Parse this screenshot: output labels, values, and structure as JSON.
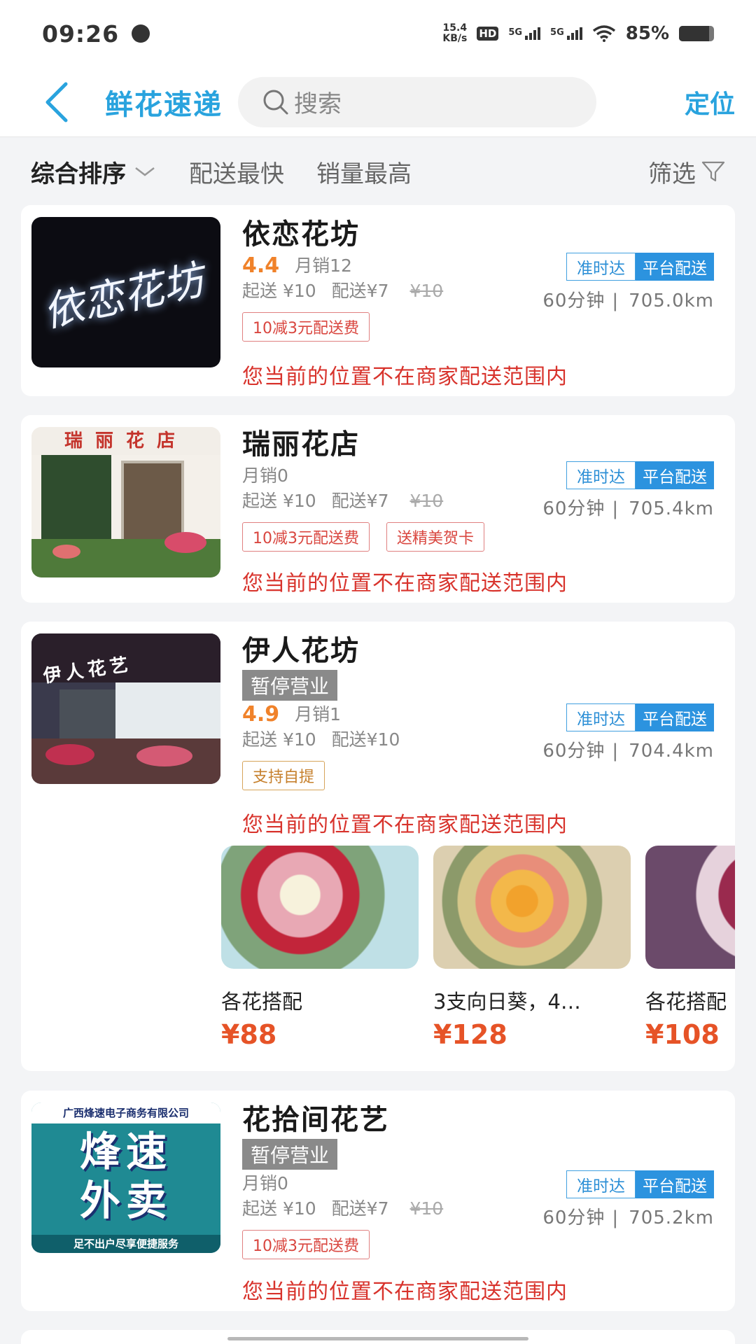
{
  "status_bar": {
    "time": "09:26",
    "net_speed_value": "15.4",
    "net_speed_unit": "KB/s",
    "hd_label": "HD",
    "network_1": "5G",
    "network_2": "5G",
    "battery_text": "85%",
    "battery_level": 0.85
  },
  "header": {
    "title": "鲜花速递",
    "search_placeholder": "搜索",
    "locate_label": "定位"
  },
  "sort_bar": {
    "items": [
      {
        "label": "综合排序"
      },
      {
        "label": "配送最快"
      },
      {
        "label": "销量最高"
      }
    ],
    "filter_label": "筛选"
  },
  "shops": [
    {
      "name": "依恋花坊",
      "rating": "4.4",
      "monthly_sales": "月销12",
      "min_order": "起送 ¥10",
      "delivery_fee": "配送¥7",
      "original_fee": "¥10",
      "tags": [
        "10减3元配送费"
      ],
      "badge_ontime": "准时达",
      "badge_platform": "平台配送",
      "time": "60分钟",
      "distance": "705.0km",
      "notice": "您当前的位置不在商家配送范围内",
      "thumb_text": "依恋花坊"
    },
    {
      "name": "瑞丽花店",
      "monthly_sales": "月销0",
      "min_order": "起送 ¥10",
      "delivery_fee": "配送¥7",
      "original_fee": "¥10",
      "tags": [
        "10减3元配送费",
        "送精美贺卡"
      ],
      "badge_ontime": "准时达",
      "badge_platform": "平台配送",
      "time": "60分钟",
      "distance": "705.4km",
      "notice": "您当前的位置不在商家配送范围内",
      "thumb_text": "瑞丽花店"
    },
    {
      "name": "伊人花坊",
      "status": "暂停营业",
      "rating": "4.9",
      "monthly_sales": "月销1",
      "min_order": "起送 ¥10",
      "delivery_fee": "配送¥10",
      "tags": [
        "支持自提"
      ],
      "badge_ontime": "准时达",
      "badge_platform": "平台配送",
      "time": "60分钟",
      "distance": "704.4km",
      "notice": "您当前的位置不在商家配送范围内",
      "thumb_text": "伊人花艺",
      "products": [
        {
          "name": "各花搭配",
          "price": "¥88"
        },
        {
          "name": "3支向日葵，4…",
          "price": "¥128"
        },
        {
          "name": "各花搭配",
          "price": "¥108"
        }
      ]
    },
    {
      "name": "花拾间花艺",
      "status": "暂停营业",
      "monthly_sales": "月销0",
      "min_order": "起送 ¥10",
      "delivery_fee": "配送¥7",
      "original_fee": "¥10",
      "tags": [
        "10减3元配送费"
      ],
      "badge_ontime": "准时达",
      "badge_platform": "平台配送",
      "time": "60分钟",
      "distance": "705.2km",
      "notice": "您当前的位置不在商家配送范围内",
      "thumb_company": "广西烽速电子商务有限公司",
      "thumb_line1": "烽速",
      "thumb_line2": "外卖",
      "thumb_slogan": "足不出户尽享便捷服务"
    }
  ]
}
